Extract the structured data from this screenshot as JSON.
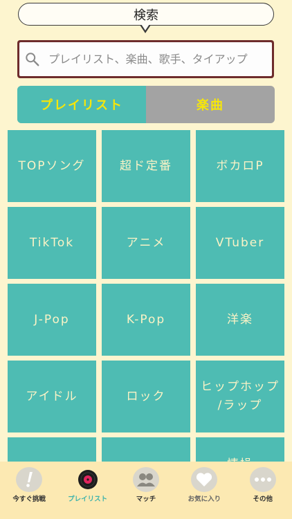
{
  "header": {
    "title": "検索"
  },
  "search": {
    "placeholder": "プレイリスト、楽曲、歌手、タイアップ"
  },
  "segment": {
    "items": [
      {
        "label": "プレイリスト",
        "active": true
      },
      {
        "label": "楽曲",
        "active": false
      }
    ]
  },
  "grid": {
    "tiles": [
      "TOPソング",
      "超ド定番",
      "ボカロP",
      "TikTok",
      "アニメ",
      "VTuber",
      "J-Pop",
      "K-Pop",
      "洋楽",
      "アイドル",
      "ロック",
      "ヒップホップ\n/ラップ",
      "",
      "",
      "情操"
    ]
  },
  "tabbar": {
    "items": [
      {
        "label": "今すぐ挑戦",
        "icon": "exclamation-icon"
      },
      {
        "label": "プレイリスト",
        "icon": "record-icon",
        "active": true
      },
      {
        "label": "マッチ",
        "icon": "people-icon"
      },
      {
        "label": "お気に入り",
        "icon": "heart-icon"
      },
      {
        "label": "その他",
        "icon": "more-icon"
      }
    ]
  },
  "colors": {
    "background": "#fdf5cf",
    "teal": "#4ebcb3",
    "yellow_text": "#f6e60a",
    "search_border": "#6e2c2c",
    "tabbar": "#fce9b2"
  }
}
